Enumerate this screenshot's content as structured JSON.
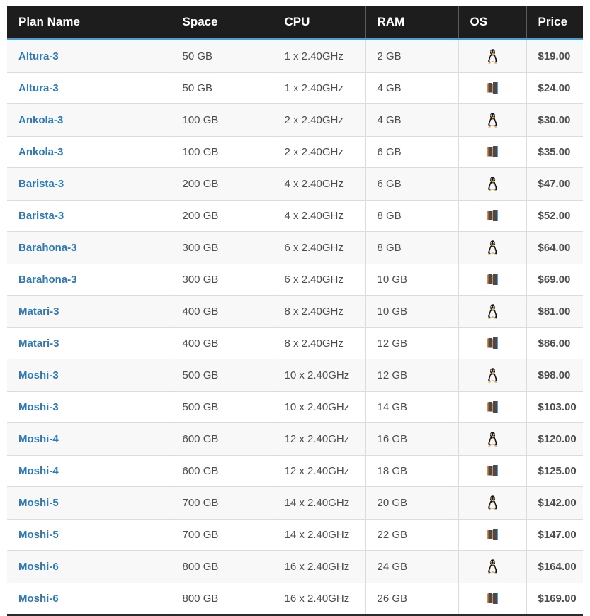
{
  "table": {
    "columns": [
      {
        "key": "plan",
        "label": "Plan Name"
      },
      {
        "key": "space",
        "label": "Space"
      },
      {
        "key": "cpu",
        "label": "CPU"
      },
      {
        "key": "ram",
        "label": "RAM"
      },
      {
        "key": "os",
        "label": "OS"
      },
      {
        "key": "price",
        "label": "Price"
      }
    ],
    "colors": {
      "header_bg": "#1d1d1d",
      "header_text": "#ffffff",
      "header_accent": "#4e9bd0",
      "link": "#2e7ab6",
      "row_alt_bg": "#f8f8f8",
      "row_bg": "#ffffff",
      "cell_text": "#4d4d4d",
      "price_text": "#3a3a3a",
      "border": "#dcdcdc",
      "table_bottom_border": "#2b2b2b"
    },
    "os_icons": {
      "linux": "linux-penguin-icon",
      "windows": "windows-logo-icon"
    },
    "rows": [
      {
        "plan": "Altura-3",
        "space": "50 GB",
        "cpu": "1 x 2.40GHz",
        "ram": "2 GB",
        "os": "linux",
        "price": "$19.00"
      },
      {
        "plan": "Altura-3",
        "space": "50 GB",
        "cpu": "1 x 2.40GHz",
        "ram": "4 GB",
        "os": "windows",
        "price": "$24.00"
      },
      {
        "plan": "Ankola-3",
        "space": "100 GB",
        "cpu": "2 x 2.40GHz",
        "ram": "4 GB",
        "os": "linux",
        "price": "$30.00"
      },
      {
        "plan": "Ankola-3",
        "space": "100 GB",
        "cpu": "2 x 2.40GHz",
        "ram": "6 GB",
        "os": "windows",
        "price": "$35.00"
      },
      {
        "plan": "Barista-3",
        "space": "200 GB",
        "cpu": "4 x 2.40GHz",
        "ram": "6 GB",
        "os": "linux",
        "price": "$47.00"
      },
      {
        "plan": "Barista-3",
        "space": "200 GB",
        "cpu": "4 x 2.40GHz",
        "ram": "8 GB",
        "os": "windows",
        "price": "$52.00"
      },
      {
        "plan": "Barahona-3",
        "space": "300 GB",
        "cpu": "6 x 2.40GHz",
        "ram": "8 GB",
        "os": "linux",
        "price": "$64.00"
      },
      {
        "plan": "Barahona-3",
        "space": "300 GB",
        "cpu": "6 x 2.40GHz",
        "ram": "10 GB",
        "os": "windows",
        "price": "$69.00"
      },
      {
        "plan": "Matari-3",
        "space": "400 GB",
        "cpu": "8 x 2.40GHz",
        "ram": "10 GB",
        "os": "linux",
        "price": "$81.00"
      },
      {
        "plan": "Matari-3",
        "space": "400 GB",
        "cpu": "8 x 2.40GHz",
        "ram": "12 GB",
        "os": "windows",
        "price": "$86.00"
      },
      {
        "plan": "Moshi-3",
        "space": "500 GB",
        "cpu": "10 x 2.40GHz",
        "ram": "12 GB",
        "os": "linux",
        "price": "$98.00"
      },
      {
        "plan": "Moshi-3",
        "space": "500 GB",
        "cpu": "10 x 2.40GHz",
        "ram": "14 GB",
        "os": "windows",
        "price": "$103.00"
      },
      {
        "plan": "Moshi-4",
        "space": "600 GB",
        "cpu": "12 x 2.40GHz",
        "ram": "16 GB",
        "os": "linux",
        "price": "$120.00"
      },
      {
        "plan": "Moshi-4",
        "space": "600 GB",
        "cpu": "12 x 2.40GHz",
        "ram": "18 GB",
        "os": "windows",
        "price": "$125.00"
      },
      {
        "plan": "Moshi-5",
        "space": "700 GB",
        "cpu": "14 x 2.40GHz",
        "ram": "20 GB",
        "os": "linux",
        "price": "$142.00"
      },
      {
        "plan": "Moshi-5",
        "space": "700 GB",
        "cpu": "14 x 2.40GHz",
        "ram": "22 GB",
        "os": "windows",
        "price": "$147.00"
      },
      {
        "plan": "Moshi-6",
        "space": "800 GB",
        "cpu": "16 x 2.40GHz",
        "ram": "24 GB",
        "os": "linux",
        "price": "$164.00"
      },
      {
        "plan": "Moshi-6",
        "space": "800 GB",
        "cpu": "16 x 2.40GHz",
        "ram": "26 GB",
        "os": "windows",
        "price": "$169.00"
      }
    ]
  }
}
